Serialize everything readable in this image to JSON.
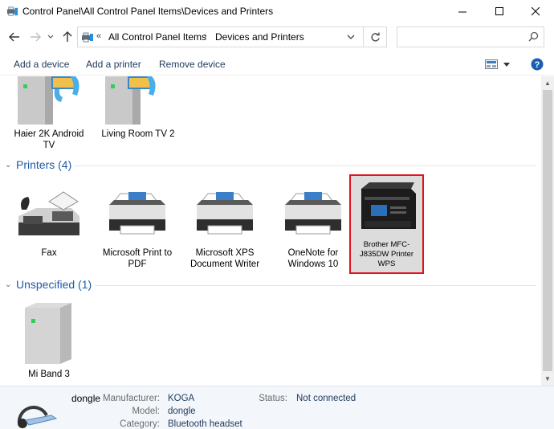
{
  "window": {
    "title": "Control Panel\\All Control Panel Items\\Devices and Printers"
  },
  "address": {
    "overflow": "«",
    "crumbs": [
      "All Control Panel Items",
      "Devices and Printers"
    ],
    "separator": "›"
  },
  "search": {
    "placeholder": "",
    "value": ""
  },
  "commands": {
    "add_device": "Add a device",
    "add_printer": "Add a printer",
    "remove_device": "Remove device"
  },
  "groups": {
    "multimedia": {
      "items": [
        {
          "label": "Haier 2K Android TV"
        },
        {
          "label": "Living Room TV 2"
        }
      ]
    },
    "printers": {
      "label": "Printers (4)",
      "items": [
        {
          "label": "Fax"
        },
        {
          "label": "Microsoft Print to PDF"
        },
        {
          "label": "Microsoft XPS Document Writer"
        },
        {
          "label": "OneNote for Windows 10"
        },
        {
          "label": "Brother MFC-J835DW Printer WPS"
        }
      ]
    },
    "unspecified": {
      "label": "Unspecified (1)",
      "items": [
        {
          "label": "Mi Band 3"
        }
      ]
    }
  },
  "details": {
    "name": "dongle",
    "manufacturer_label": "Manufacturer:",
    "manufacturer": "KOGA",
    "model_label": "Model:",
    "model": "dongle",
    "category_label": "Category:",
    "category": "Bluetooth headset",
    "status_label": "Status:",
    "status": "Not connected"
  },
  "colors": {
    "accent": "#1e5aa8",
    "selection_border": "#e0141e",
    "help": "#1a5fb4"
  }
}
